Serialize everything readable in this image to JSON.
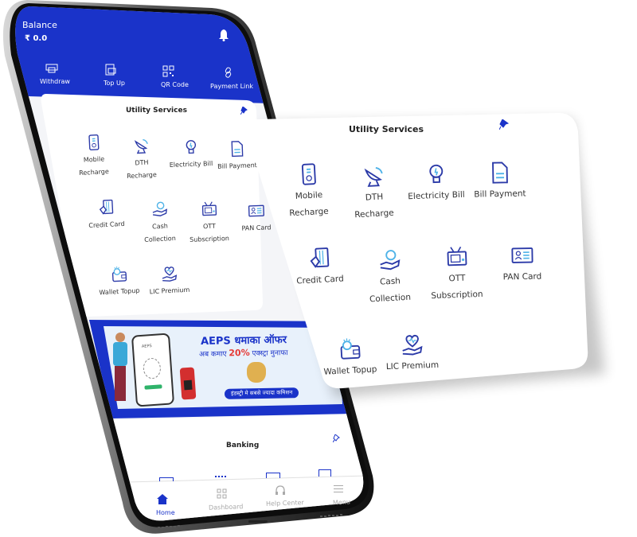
{
  "header": {
    "balance_label": "Balance",
    "balance_value": "₹ 0.0",
    "bell_icon": "bell-icon",
    "color": "#1a33c9"
  },
  "quick_actions": [
    {
      "label": "Withdraw",
      "icon": "atm-icon"
    },
    {
      "label": "Top Up",
      "icon": "topup-icon"
    },
    {
      "label": "QR Code",
      "icon": "qr-code-icon"
    },
    {
      "label": "Payment Link",
      "icon": "link-icon"
    }
  ],
  "utility_services": {
    "title": "Utility Services",
    "pin_icon": "pin-icon",
    "items": [
      {
        "label_1": "Mobile",
        "label_2": "Recharge",
        "icon": "mobile-recharge-icon"
      },
      {
        "label_1": "DTH",
        "label_2": "Recharge",
        "icon": "satellite-dish-icon"
      },
      {
        "label_1": "Electricity Bill",
        "label_2": "",
        "icon": "bulb-icon"
      },
      {
        "label_1": "Bill Payment",
        "label_2": "",
        "icon": "bill-icon"
      },
      {
        "label_1": "Credit Card",
        "label_2": "",
        "icon": "credit-card-icon"
      },
      {
        "label_1": "Cash",
        "label_2": "Collection",
        "icon": "cash-hand-icon"
      },
      {
        "label_1": "OTT",
        "label_2": "Subscription",
        "icon": "tv-icon"
      },
      {
        "label_1": "PAN Card",
        "label_2": "",
        "icon": "id-card-icon"
      },
      {
        "label_1": "Wallet Topup",
        "label_2": "",
        "icon": "wallet-icon"
      },
      {
        "label_1": "LIC Premium",
        "label_2": "",
        "icon": "heart-hand-icon"
      }
    ]
  },
  "banner": {
    "title": "AEPS धमाका ऑफर",
    "subtitle_pre": "अब कमाए ",
    "subtitle_highlight": "20%",
    "subtitle_post": " एक्स्ट्रा मुनाफा",
    "phone_label": "AEPS",
    "cta": "इंडस्ट्री मे सबसे ज्यादा कमिशन",
    "accent": "#e53935"
  },
  "banking": {
    "title": "Banking"
  },
  "bottom_nav": [
    {
      "label": "Home",
      "icon": "home-icon",
      "active": true
    },
    {
      "label": "Dashboard",
      "icon": "dashboard-icon",
      "active": false
    },
    {
      "label": "Help Center",
      "icon": "headset-icon",
      "active": false
    },
    {
      "label": "Menu",
      "icon": "menu-icon",
      "active": false
    }
  ]
}
